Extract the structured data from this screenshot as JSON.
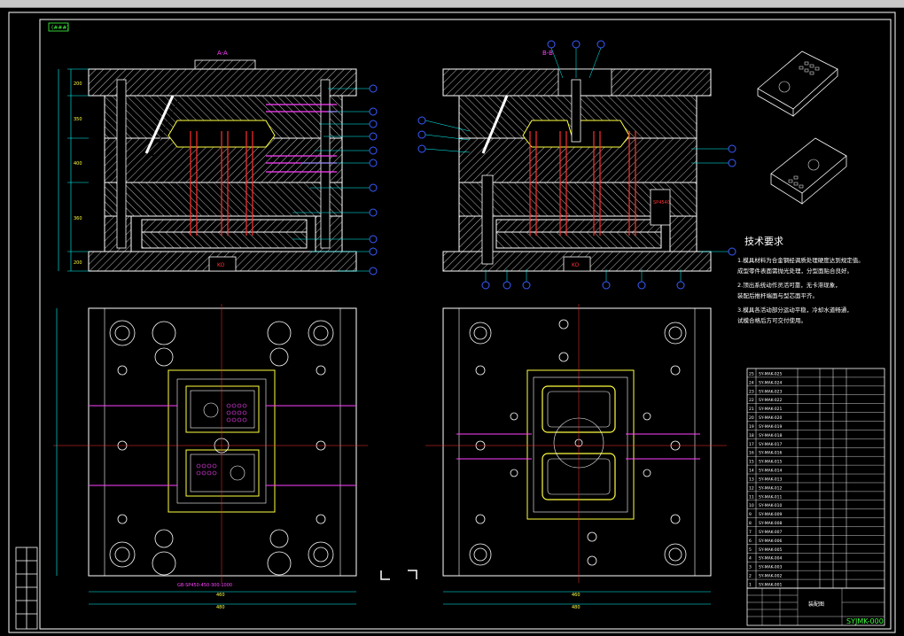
{
  "window": {
    "top_bar_color": "#c8c8c8"
  },
  "colors": {
    "bg": "#000000",
    "line": "#ffffff",
    "hatch": "#c8c8c8",
    "cyan": "#00ffff",
    "blue": "#3a5bff",
    "red": "#ff3030",
    "magenta": "#ff40ff",
    "yellow": "#ffff40",
    "green": "#40ff40"
  },
  "sheet": {
    "corner_tag": "(###)",
    "section_a_title": "A-A",
    "section_b_title": "B-B",
    "plate_labels": {
      "left": "KO",
      "right": "KO"
    },
    "dims_left_side": [
      "200",
      "350",
      "400",
      "360",
      "200"
    ],
    "bottom_dims": {
      "plan_left_mid": "460",
      "plan_left_outer": "480",
      "plan_right_mid": "460",
      "plan_right_outer": "480"
    },
    "left_plan_note": "GB-SP450-450-300-1000",
    "right_section_callout": "SP4540"
  },
  "tech_req": {
    "title": "技术要求",
    "lines": [
      "1.模具材料为合金钢经调质处理硬度达到规定值。",
      "  成型零件表面需抛光处理，分型面贴合良好。",
      "2.顶出系统动作灵活可靠，无卡滞现象，",
      "  装配后推杆端面与型芯面平齐。",
      "3.模具各活动部分运动平稳，冷却水道畅通，",
      "  试模合格后方可交付使用。"
    ]
  },
  "parts_table": {
    "rows": [
      [
        "25",
        "SY-MAK-025"
      ],
      [
        "24",
        "SY-MAK-024"
      ],
      [
        "23",
        "SY-MAK-023"
      ],
      [
        "22",
        "SY-MAK-022"
      ],
      [
        "21",
        "SY-MAK-021"
      ],
      [
        "20",
        "SY-MAK-020"
      ],
      [
        "19",
        "SY-MAK-019"
      ],
      [
        "18",
        "SY-MAK-018"
      ],
      [
        "17",
        "SY-MAK-017"
      ],
      [
        "16",
        "SY-MAK-016"
      ],
      [
        "15",
        "SY-MAK-015"
      ],
      [
        "14",
        "SY-MAK-014"
      ],
      [
        "13",
        "SY-MAK-013"
      ],
      [
        "12",
        "SY-MAK-012"
      ],
      [
        "11",
        "SY-MAK-011"
      ],
      [
        "10",
        "SY-MAK-010"
      ],
      [
        "9",
        "SY-MAK-009"
      ],
      [
        "8",
        "SY-MAK-008"
      ],
      [
        "7",
        "SY-MAK-007"
      ],
      [
        "6",
        "SY-MAK-006"
      ],
      [
        "5",
        "SY-MAK-005"
      ],
      [
        "4",
        "SY-MAK-004"
      ],
      [
        "3",
        "SY-MAK-003"
      ],
      [
        "2",
        "SY-MAK-002"
      ],
      [
        "1",
        "SY-MAK-001"
      ]
    ],
    "title_block_label": "装配图",
    "drawing_no": "SYJMK-000"
  }
}
